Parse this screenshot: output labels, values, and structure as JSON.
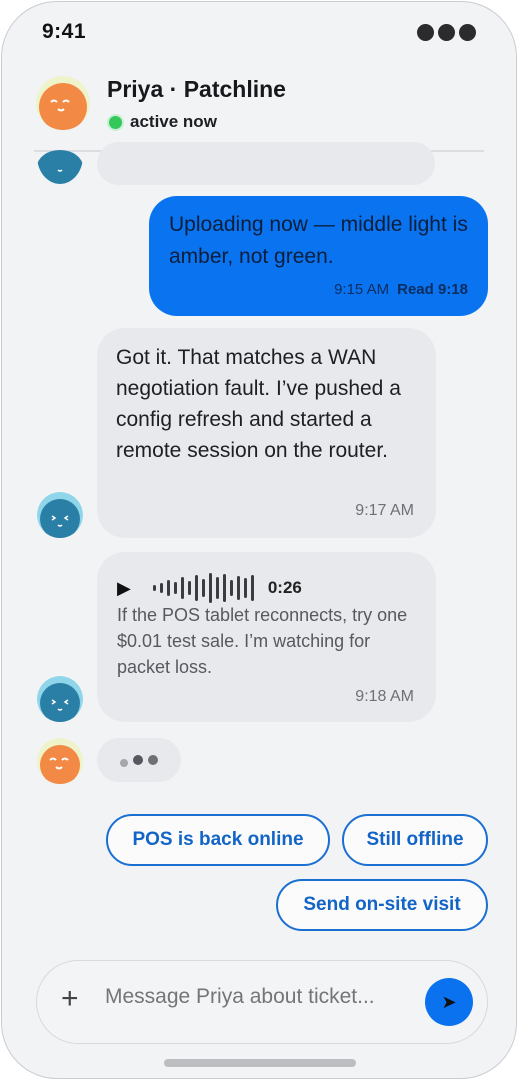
{
  "status_bar": {
    "time": "9:41"
  },
  "header": {
    "name": "Priya · Patchline",
    "presence": "active now"
  },
  "messages": {
    "outgoing": {
      "text": "Uploading now — middle light is amber, not green.",
      "time": "9:15 AM",
      "receipt": "Read 9:18"
    },
    "incoming_text": {
      "text": "Got it. That matches a WAN negotiation fault. I’ve pushed a config refresh and started a remote session on the router.",
      "time": "9:17 AM"
    },
    "incoming_voice": {
      "duration": "0:26",
      "transcript": "If the POS tablet reconnects, try one $0.01 test sale. I’m watching for packet loss.",
      "time": "9:18 AM"
    }
  },
  "quick_replies": [
    "POS is back online",
    "Still offline",
    "Send on-site visit"
  ],
  "composer": {
    "placeholder": "Message Priya about ticket..."
  },
  "colors": {
    "accent": "#0a74f0",
    "online": "#34c759",
    "avatar_user": "#f28a45",
    "avatar_agent": "#2a7fa6"
  },
  "icons": {
    "add": "plus-icon",
    "send": "send-icon",
    "play": "play-icon"
  }
}
